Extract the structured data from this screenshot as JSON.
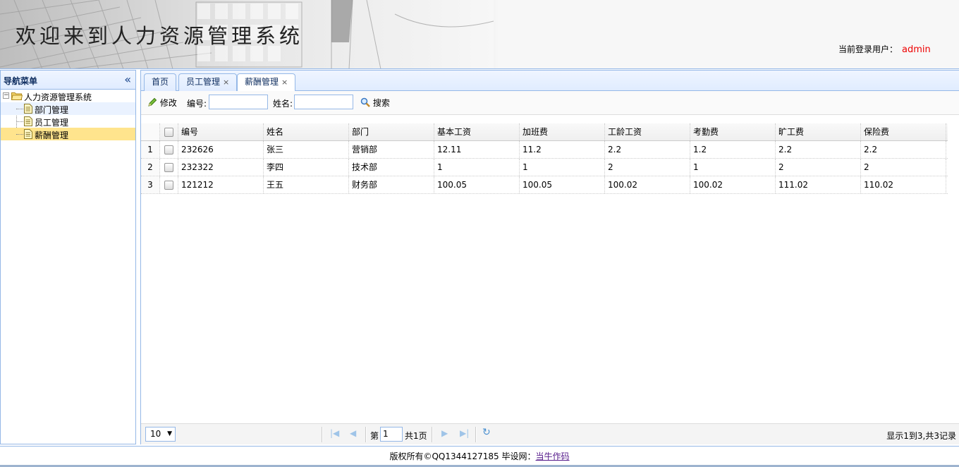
{
  "header": {
    "title": "欢迎来到人力资源管理系统",
    "user_label": "当前登录用户：",
    "username": "admin"
  },
  "nav": {
    "title": "导航菜单",
    "collapse_icon": "double-chevron-left-icon",
    "root": "人力资源管理系统",
    "items": [
      {
        "label": "部门管理"
      },
      {
        "label": "员工管理"
      },
      {
        "label": "薪酬管理"
      }
    ],
    "selected": "薪酬管理"
  },
  "tabs": [
    {
      "label": "首页",
      "closable": false
    },
    {
      "label": "员工管理",
      "closable": true
    },
    {
      "label": "薪酬管理",
      "closable": true,
      "active": true
    }
  ],
  "toolbar": {
    "edit_label": "修改",
    "id_label": "编号:",
    "id_value": "",
    "name_label": "姓名:",
    "name_value": "",
    "search_label": "搜索"
  },
  "grid": {
    "columns": [
      "编号",
      "姓名",
      "部门",
      "基本工资",
      "加班费",
      "工龄工资",
      "考勤费",
      "旷工费",
      "保险费"
    ],
    "rows": [
      {
        "num": "1",
        "cells": [
          "232626",
          "张三",
          "营销部",
          "12.11",
          "11.2",
          "2.2",
          "1.2",
          "2.2",
          "2.2"
        ]
      },
      {
        "num": "2",
        "cells": [
          "232322",
          "李四",
          "技术部",
          "1",
          "1",
          "2",
          "1",
          "2",
          "2"
        ]
      },
      {
        "num": "3",
        "cells": [
          "121212",
          "王五",
          "财务部",
          "100.05",
          "100.05",
          "100.02",
          "100.02",
          "111.02",
          "110.02"
        ]
      }
    ]
  },
  "pager": {
    "page_size": "10",
    "page_prefix": "第",
    "page_value": "1",
    "page_total": "共1页",
    "info": "显示1到3,共3记录"
  },
  "footer": {
    "text": "版权所有©QQ1344127185 毕设网：",
    "link": "当牛作码"
  }
}
